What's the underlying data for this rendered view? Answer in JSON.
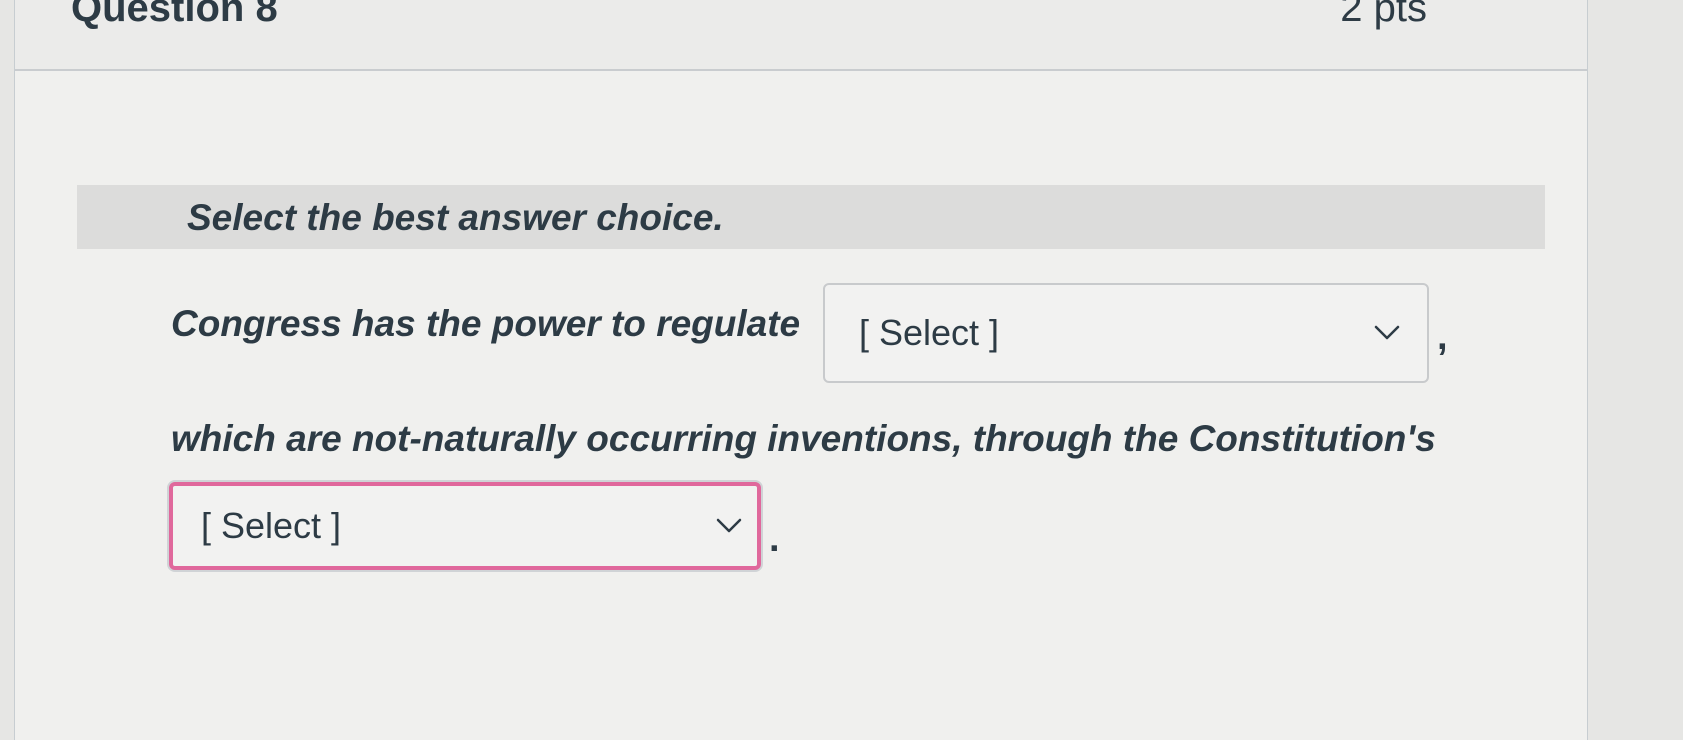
{
  "question": {
    "title": "Question 8",
    "points": "2 pts"
  },
  "instruction": "Select the best answer choice.",
  "prompt": {
    "part1": "Congress has the power to regulate",
    "comma": ",",
    "part2": "which are not-naturally occurring inventions, through the Constitution's",
    "period": "."
  },
  "dropdowns": [
    {
      "selected": "[ Select ]",
      "icon": "chevron-down-icon"
    },
    {
      "selected": "[ Select ]",
      "icon": "chevron-down-icon",
      "focused": true,
      "focus_color": "#e0689c"
    }
  ]
}
